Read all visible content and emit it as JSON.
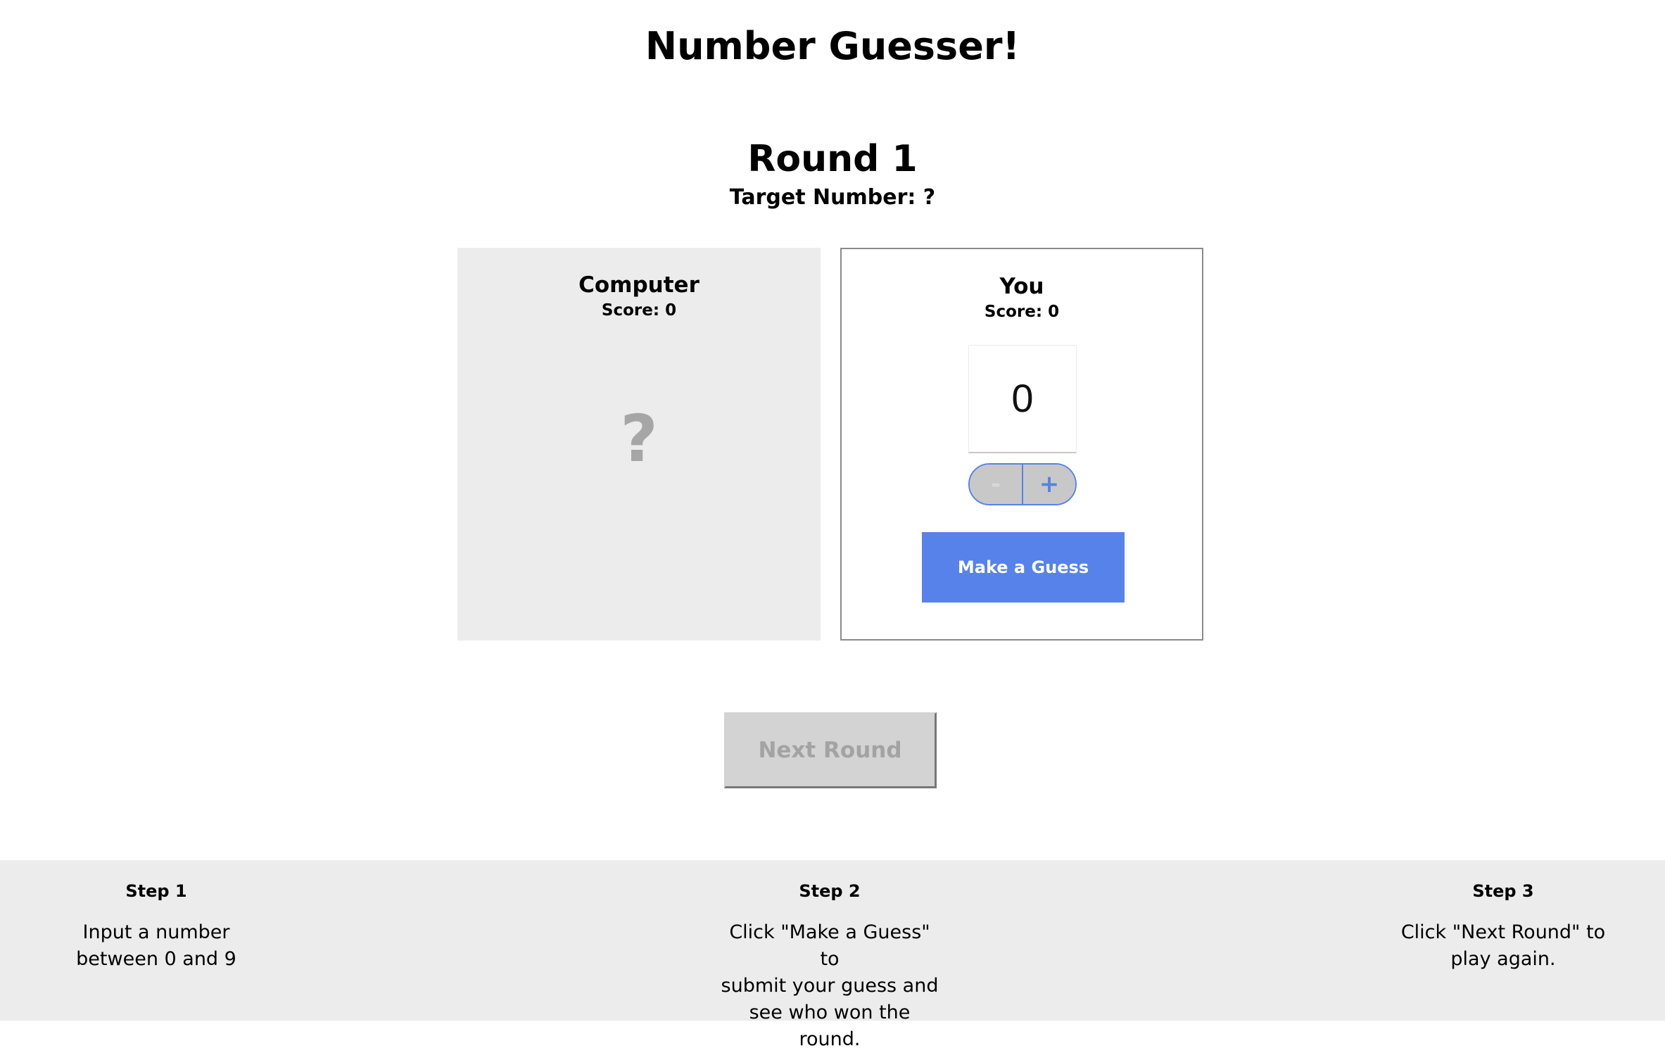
{
  "header": {
    "title": "Number Guesser!"
  },
  "round": {
    "label": "Round 1",
    "target_text": "Target Number: ?"
  },
  "computer": {
    "name": "Computer",
    "score_text": "Score: 0",
    "guess": "?"
  },
  "player": {
    "name": "You",
    "score_text": "Score: 0",
    "guess_value": "0",
    "decrement_label": "-",
    "increment_label": "+",
    "guess_button_label": "Make a Guess"
  },
  "next_round": {
    "label": "Next Round",
    "enabled": false
  },
  "instructions": [
    {
      "title": "Step 1",
      "lines": [
        "Input a number",
        "between 0 and 9"
      ]
    },
    {
      "title": "Step 2",
      "lines": [
        "Click \"Make a Guess\" to",
        "submit your guess and",
        "see who won the round."
      ]
    },
    {
      "title": "Step 3",
      "lines": [
        "Click \"Next Round\" to",
        "play again."
      ]
    }
  ],
  "colors": {
    "accent": "#5682ea",
    "panel_gray": "#ececec",
    "disabled_button": "#d3d3d3",
    "muted_text": "#a3a3a3"
  }
}
